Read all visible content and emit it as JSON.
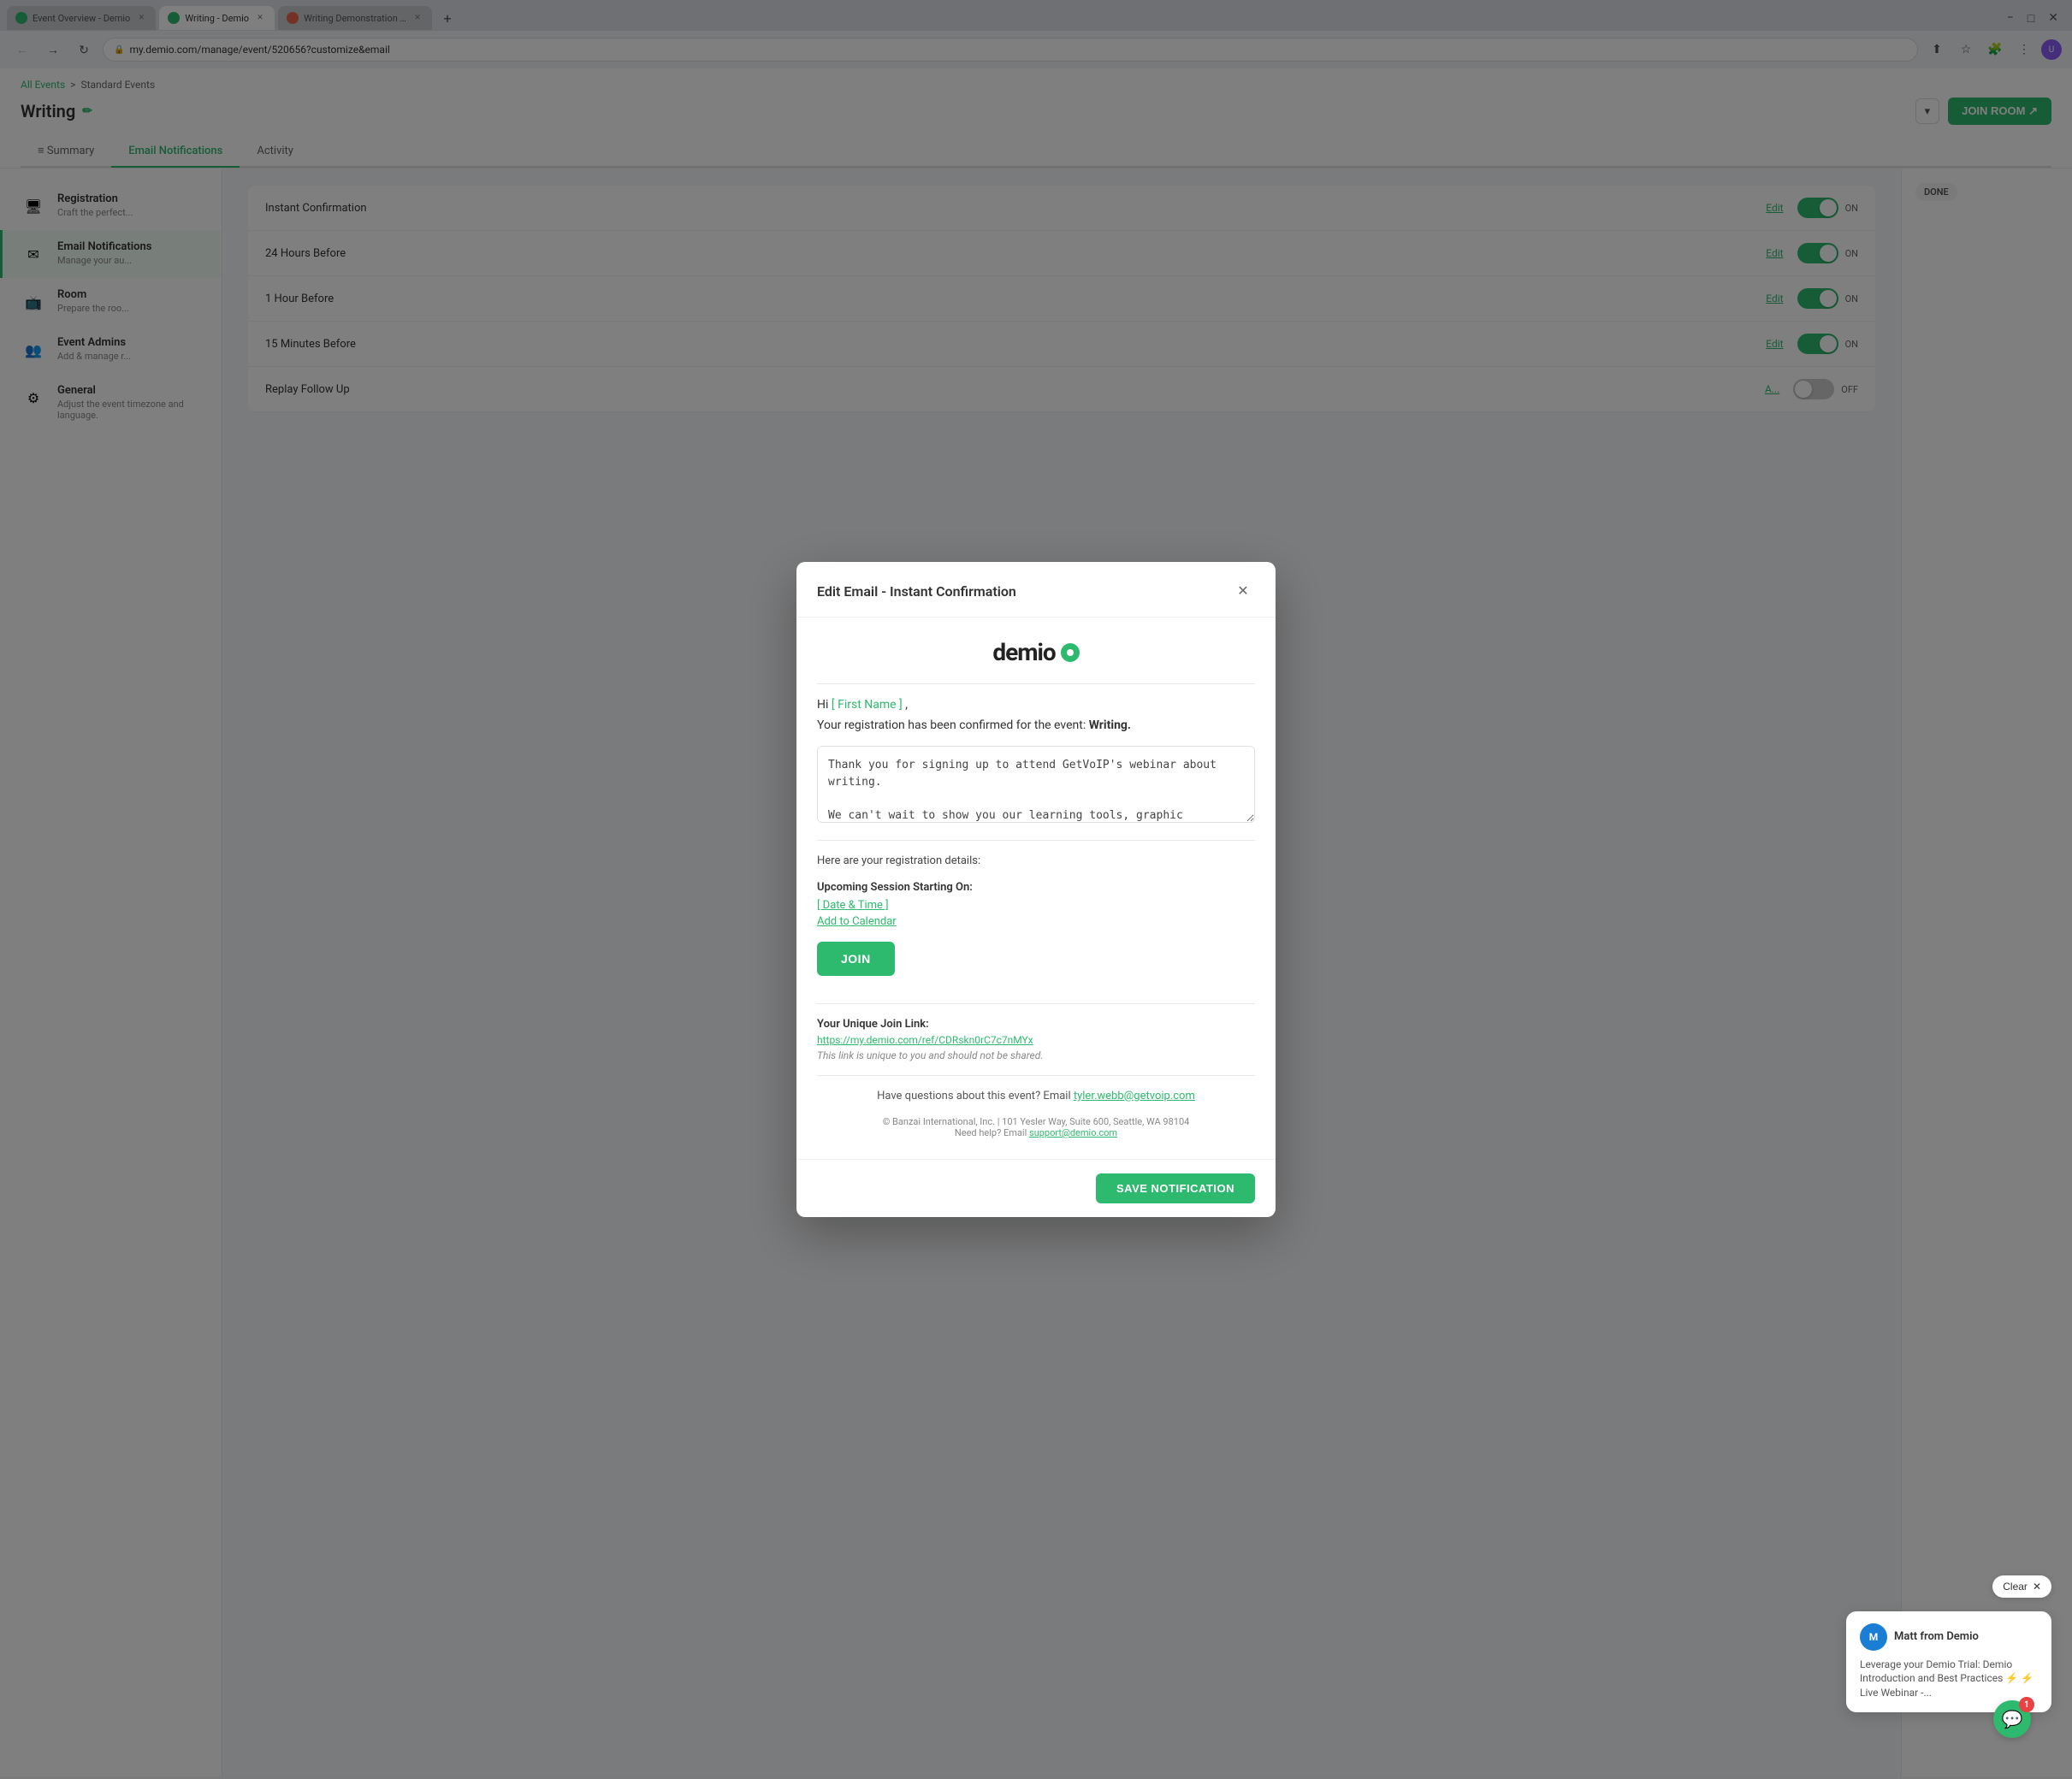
{
  "browser": {
    "tabs": [
      {
        "id": "tab1",
        "label": "Event Overview - Demio",
        "favicon": "green",
        "active": false
      },
      {
        "id": "tab2",
        "label": "Writing - Demio",
        "favicon": "green",
        "active": true
      },
      {
        "id": "tab3",
        "label": "Writing Demonstration - Demio",
        "favicon": "orange",
        "active": false
      }
    ],
    "url": "my.demio.com/manage/event/520656?customize&email",
    "new_tab_label": "+"
  },
  "page": {
    "breadcrumb": {
      "all_events": "All Events",
      "separator": ">",
      "standard_events": "Standard Events"
    },
    "title": "Writing",
    "join_room_label": "JOIN ROOM ↗"
  },
  "tabs": [
    {
      "id": "summary",
      "label": "Summary"
    },
    {
      "id": "email-notifications",
      "label": "Email Notifications",
      "active": true
    },
    {
      "id": "activity",
      "label": "Activity"
    }
  ],
  "sidebar": {
    "items": [
      {
        "id": "registration",
        "icon": "🖥",
        "title": "Registration",
        "desc": "Craft the perfect..."
      },
      {
        "id": "email-notifications",
        "icon": "✉",
        "title": "Email Notifications",
        "desc": "Manage your au...",
        "active": true
      },
      {
        "id": "room",
        "icon": "📺",
        "title": "Room",
        "desc": "Prepare the roo..."
      },
      {
        "id": "event-admins",
        "icon": "👥",
        "title": "Event Admins",
        "desc": "Add & manage r..."
      },
      {
        "id": "general",
        "icon": "⚙",
        "title": "General",
        "desc": "Adjust the event timezone and language."
      }
    ]
  },
  "email_rows": [
    {
      "id": "instant-confirmation",
      "name": "Instant Confirmation",
      "toggle": "on"
    },
    {
      "id": "24-hours-before",
      "name": "24 Hours Before",
      "toggle": "on"
    },
    {
      "id": "1-hour-before",
      "name": "1 Hour Before",
      "toggle": "on"
    },
    {
      "id": "15-minutes-before",
      "name": "15 Minutes Before",
      "toggle": "on"
    },
    {
      "id": "replay-follow-up",
      "name": "Replay Follow Up",
      "toggle": "off"
    }
  ],
  "modal": {
    "title": "Edit Email - Instant Confirmation",
    "logo_text": "demio",
    "greeting": "Hi",
    "first_name_placeholder": "[ First Name ]",
    "greeting_comma": ",",
    "confirmation_text": "Your registration has been confirmed for the event:",
    "event_name": "Writing.",
    "body_text": "Thank you for signing up to attend GetVoIP's webinar about writing.\n\nWe can't wait to show you our learning tools, graphic organizers, and strategies. Below, find all information about your event, and please reach out with any questions.",
    "registration_details_title": "Here are your registration details:",
    "session_title": "Upcoming Session Starting On:",
    "date_time_placeholder": "[ Date & Time ]",
    "add_to_calendar": "Add to Calendar",
    "join_button": "JOIN",
    "unique_link_title": "Your Unique Join Link:",
    "join_url": "https://my.demio.com/ref/CDRskn0rC7c7nMYx",
    "unique_note": "This link is unique to you and should not be shared.",
    "questions_text": "Have questions about this event? Email",
    "questions_email": "tyler.webb@getvoip.com",
    "copyright": "© Banzai International, Inc. | 101 Yesler Way, Suite 600, Seattle, WA 98104",
    "help_text": "Need help? Email",
    "support_email": "support@demio.com",
    "save_button": "SAVE NOTIFICATION"
  },
  "chat": {
    "clear_label": "Clear",
    "clear_icon": "✕",
    "sender": "Matt from Demio",
    "message": "Leverage your Demio Trial: Demio Introduction and Best Practices ⚡ ⚡ Live Webinar -...",
    "badge_count": "1"
  },
  "activity": {
    "done_label": "DONE"
  }
}
